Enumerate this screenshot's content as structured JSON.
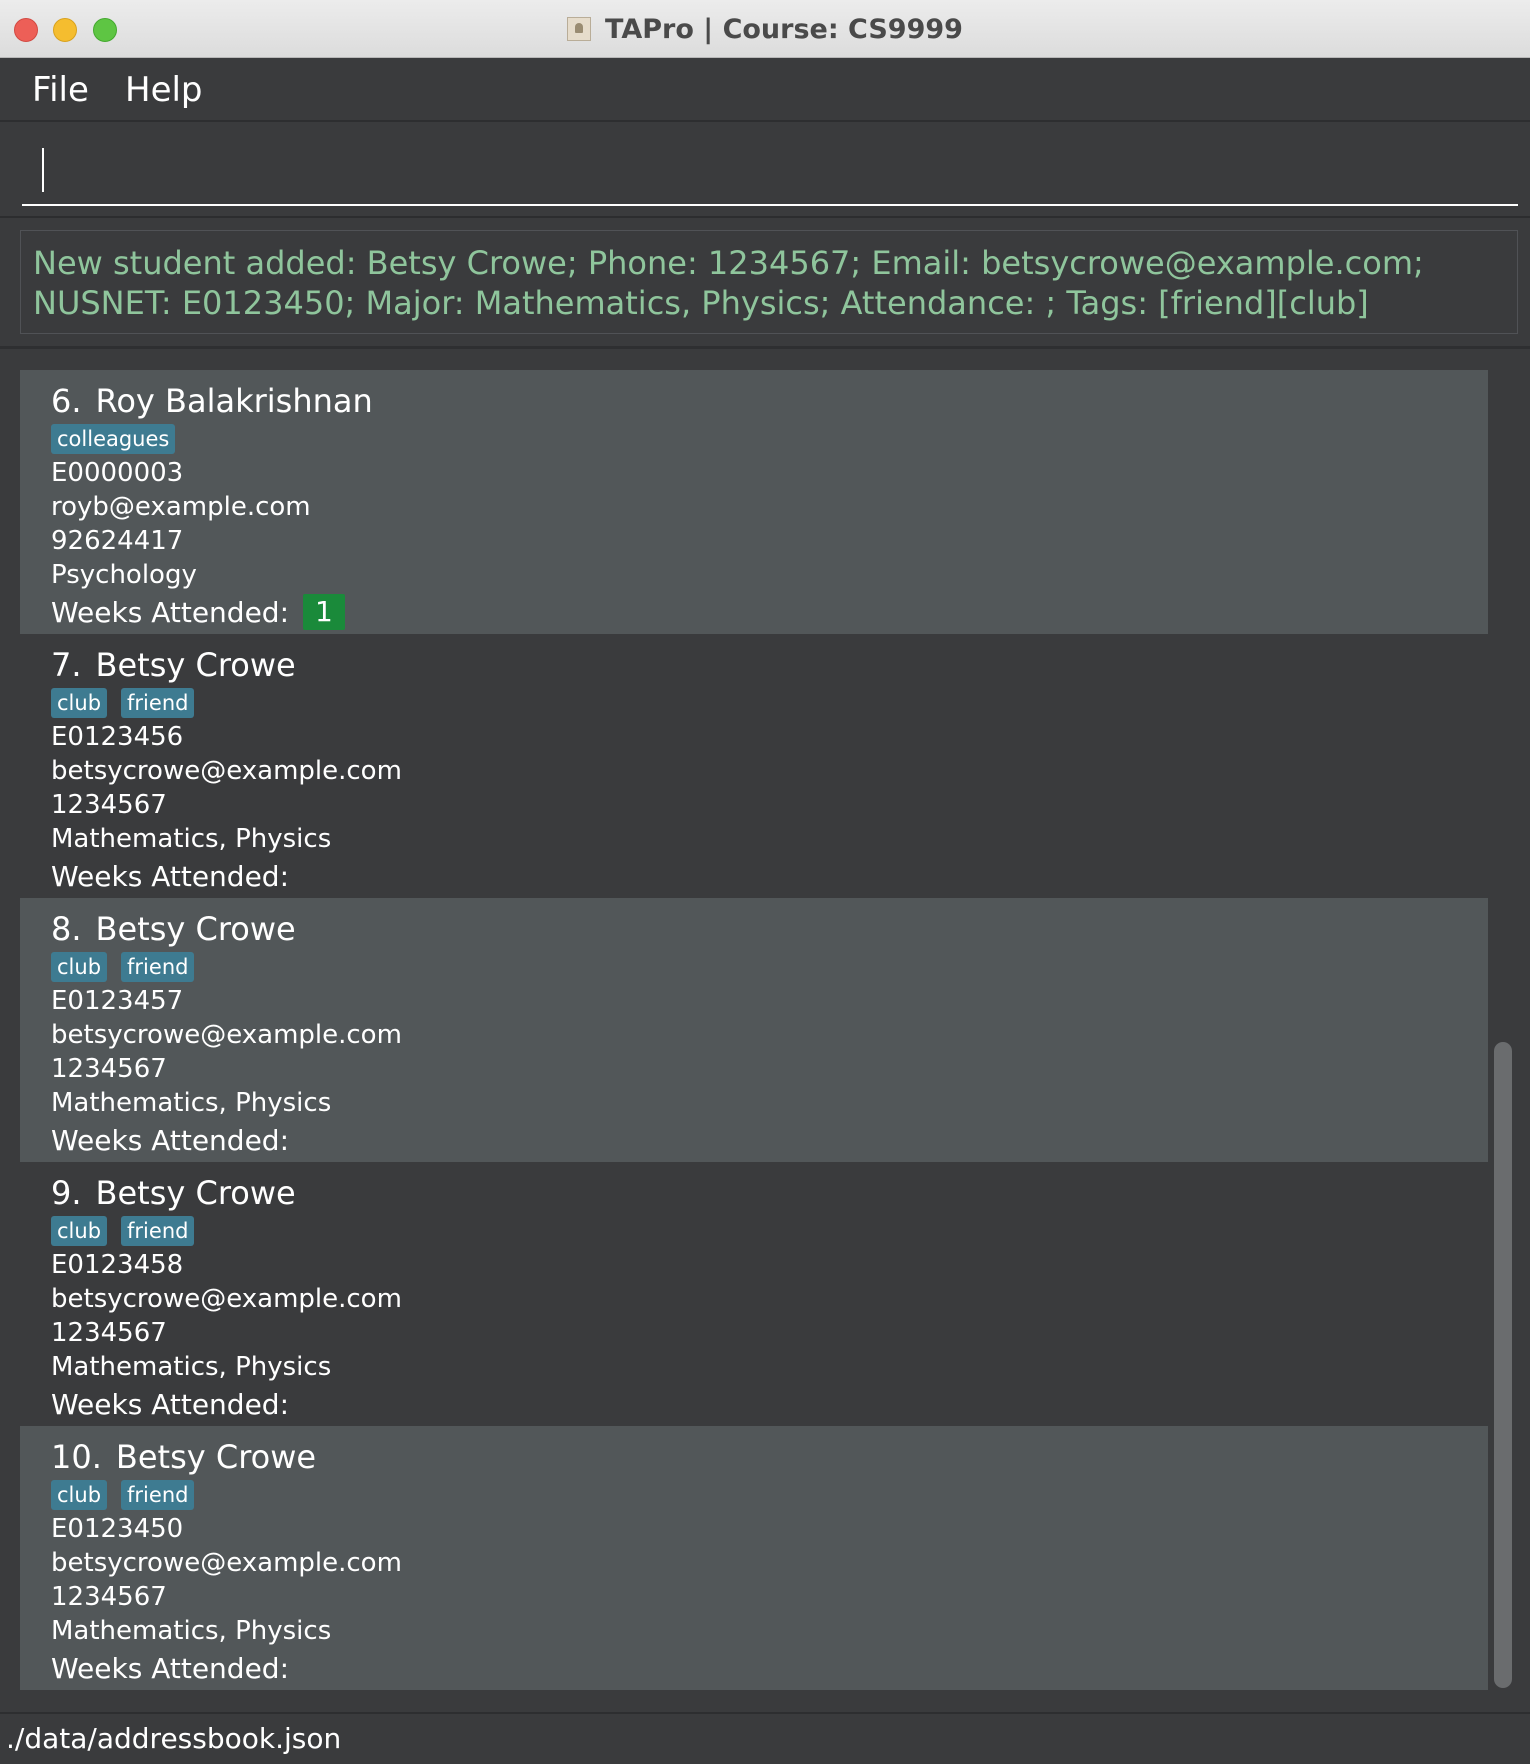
{
  "window": {
    "title": "TAPro | Course: CS9999"
  },
  "menu": {
    "file": "File",
    "help": "Help"
  },
  "command": {
    "value": "",
    "placeholder": ""
  },
  "result": {
    "message": "New student added: Betsy Crowe; Phone: 1234567; Email: betsycrowe@example.com; NUSNET: E0123450; Major: Mathematics, Physics; Attendance: ; Tags: [friend][club]"
  },
  "students": [
    {
      "index": "6.",
      "name": "Roy Balakrishnan",
      "tags": [
        "colleagues"
      ],
      "nusnet": "E0000003",
      "email": "royb@example.com",
      "phone": "92624417",
      "major": "Psychology",
      "weeks_label": "Weeks Attended:",
      "weeks": [
        "1"
      ]
    },
    {
      "index": "7.",
      "name": "Betsy Crowe",
      "tags": [
        "club",
        "friend"
      ],
      "nusnet": "E0123456",
      "email": "betsycrowe@example.com",
      "phone": "1234567",
      "major": "Mathematics, Physics",
      "weeks_label": "Weeks Attended:",
      "weeks": []
    },
    {
      "index": "8.",
      "name": "Betsy Crowe",
      "tags": [
        "club",
        "friend"
      ],
      "nusnet": "E0123457",
      "email": "betsycrowe@example.com",
      "phone": "1234567",
      "major": "Mathematics, Physics",
      "weeks_label": "Weeks Attended:",
      "weeks": []
    },
    {
      "index": "9.",
      "name": "Betsy Crowe",
      "tags": [
        "club",
        "friend"
      ],
      "nusnet": "E0123458",
      "email": "betsycrowe@example.com",
      "phone": "1234567",
      "major": "Mathematics, Physics",
      "weeks_label": "Weeks Attended:",
      "weeks": []
    },
    {
      "index": "10.",
      "name": "Betsy Crowe",
      "tags": [
        "club",
        "friend"
      ],
      "nusnet": "E0123450",
      "email": "betsycrowe@example.com",
      "phone": "1234567",
      "major": "Mathematics, Physics",
      "weeks_label": "Weeks Attended:",
      "weeks": []
    }
  ],
  "status": {
    "path": "./data/addressbook.json"
  },
  "colors": {
    "tag": "#3e7b91",
    "week_badge": "#1a8a3a",
    "result_text": "#8fc59c",
    "card_alt": "#525759",
    "card_base": "#3a3b3d"
  }
}
